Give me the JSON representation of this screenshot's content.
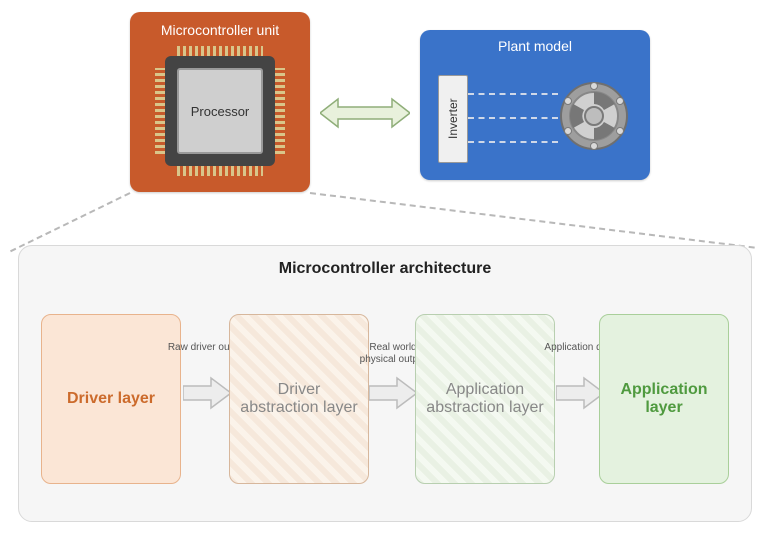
{
  "top": {
    "mcu_title": "Microcontroller unit",
    "processor_label": "Processor",
    "plant_title": "Plant model",
    "inverter_label": "Inverter"
  },
  "arch": {
    "title": "Microcontroller architecture",
    "layers": [
      "Driver layer",
      "Driver abstraction layer",
      "Application abstraction layer",
      "Application layer"
    ],
    "arrow_labels": [
      "Raw driver output",
      "Real world physical output",
      "Application data"
    ]
  }
}
